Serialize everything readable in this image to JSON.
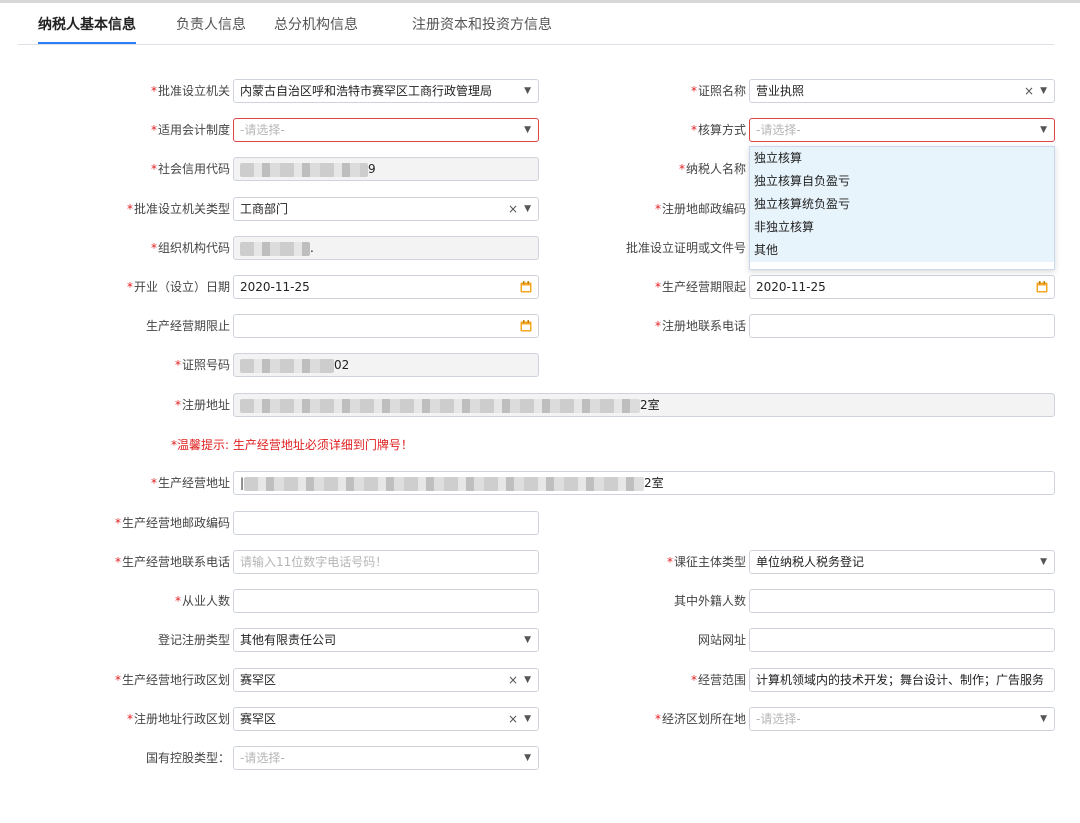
{
  "tabs": [
    "纳税人基本信息",
    "负责人信息",
    "总分机构信息",
    "注册资本和投资方信息"
  ],
  "active_tab": 0,
  "required_mark": "*",
  "placeholders": {
    "select": "-请选择-",
    "phone": "请输入11位数字电话号码！"
  },
  "labels": {
    "approval_org": "批准设立机关",
    "license_name": "证照名称",
    "accounting_system": "适用会计制度",
    "accounting_method": "核算方式",
    "credit_code": "社会信用代码",
    "taxpayer_name": "纳税人名称",
    "approval_org_type": "批准设立机关类型",
    "reg_postcode": "注册地邮政编码",
    "org_code": "组织机构代码",
    "approval_doc": "批准设立证明或文件号",
    "open_date": "开业（设立）日期",
    "period_start": "生产经营期限起",
    "period_end": "生产经营期限止",
    "reg_phone": "注册地联系电话",
    "license_no": "证照号码",
    "reg_address": "注册地址",
    "biz_address": "生产经营地址",
    "biz_postcode": "生产经营地邮政编码",
    "biz_phone": "生产经营地联系电话",
    "levy_subject": "课征主体类型",
    "employees": "从业人数",
    "foreign_employees": "其中外籍人数",
    "reg_type": "登记注册类型",
    "website": "网站网址",
    "biz_district": "生产经营地行政区划",
    "biz_scope": "经营范围",
    "reg_district": "注册地址行政区划",
    "econ_zone": "经济区划所在地",
    "state_holding": "国有控股类型："
  },
  "values": {
    "approval_org": "内蒙古自治区呼和浩特市赛罕区工商行政管理局",
    "license_name": "营业执照",
    "credit_code_suffix": "9",
    "approval_org_type": "工商部门",
    "org_code_suffix": ".",
    "open_date": "2020-11-25",
    "period_start": "2020-11-25",
    "license_no_suffix": "02",
    "reg_address_suffix": "2室",
    "biz_address_prefix": "|",
    "biz_address_suffix": "2室",
    "levy_subject": "单位纳税人税务登记",
    "reg_type": "其他有限责任公司",
    "biz_district": "赛罕区",
    "biz_scope": "计算机领域内的技术开发；舞台设计、制作；广告服务",
    "reg_district": "赛罕区"
  },
  "tip": "*温馨提示: 生产经营地址必须详细到门牌号！",
  "accounting_options": [
    "独立核算",
    "独立核算自负盈亏",
    "独立核算统负盈亏",
    "非独立核算",
    "其他"
  ],
  "icons": {
    "caret": "▼",
    "clear": "×",
    "calendar": "calendar-icon"
  },
  "colors": {
    "required": "#e02020",
    "accent": "#2d7ff9",
    "error_border": "#e04444",
    "dropdown_bg": "#e8f4fb",
    "calendar": "#f5a623"
  }
}
